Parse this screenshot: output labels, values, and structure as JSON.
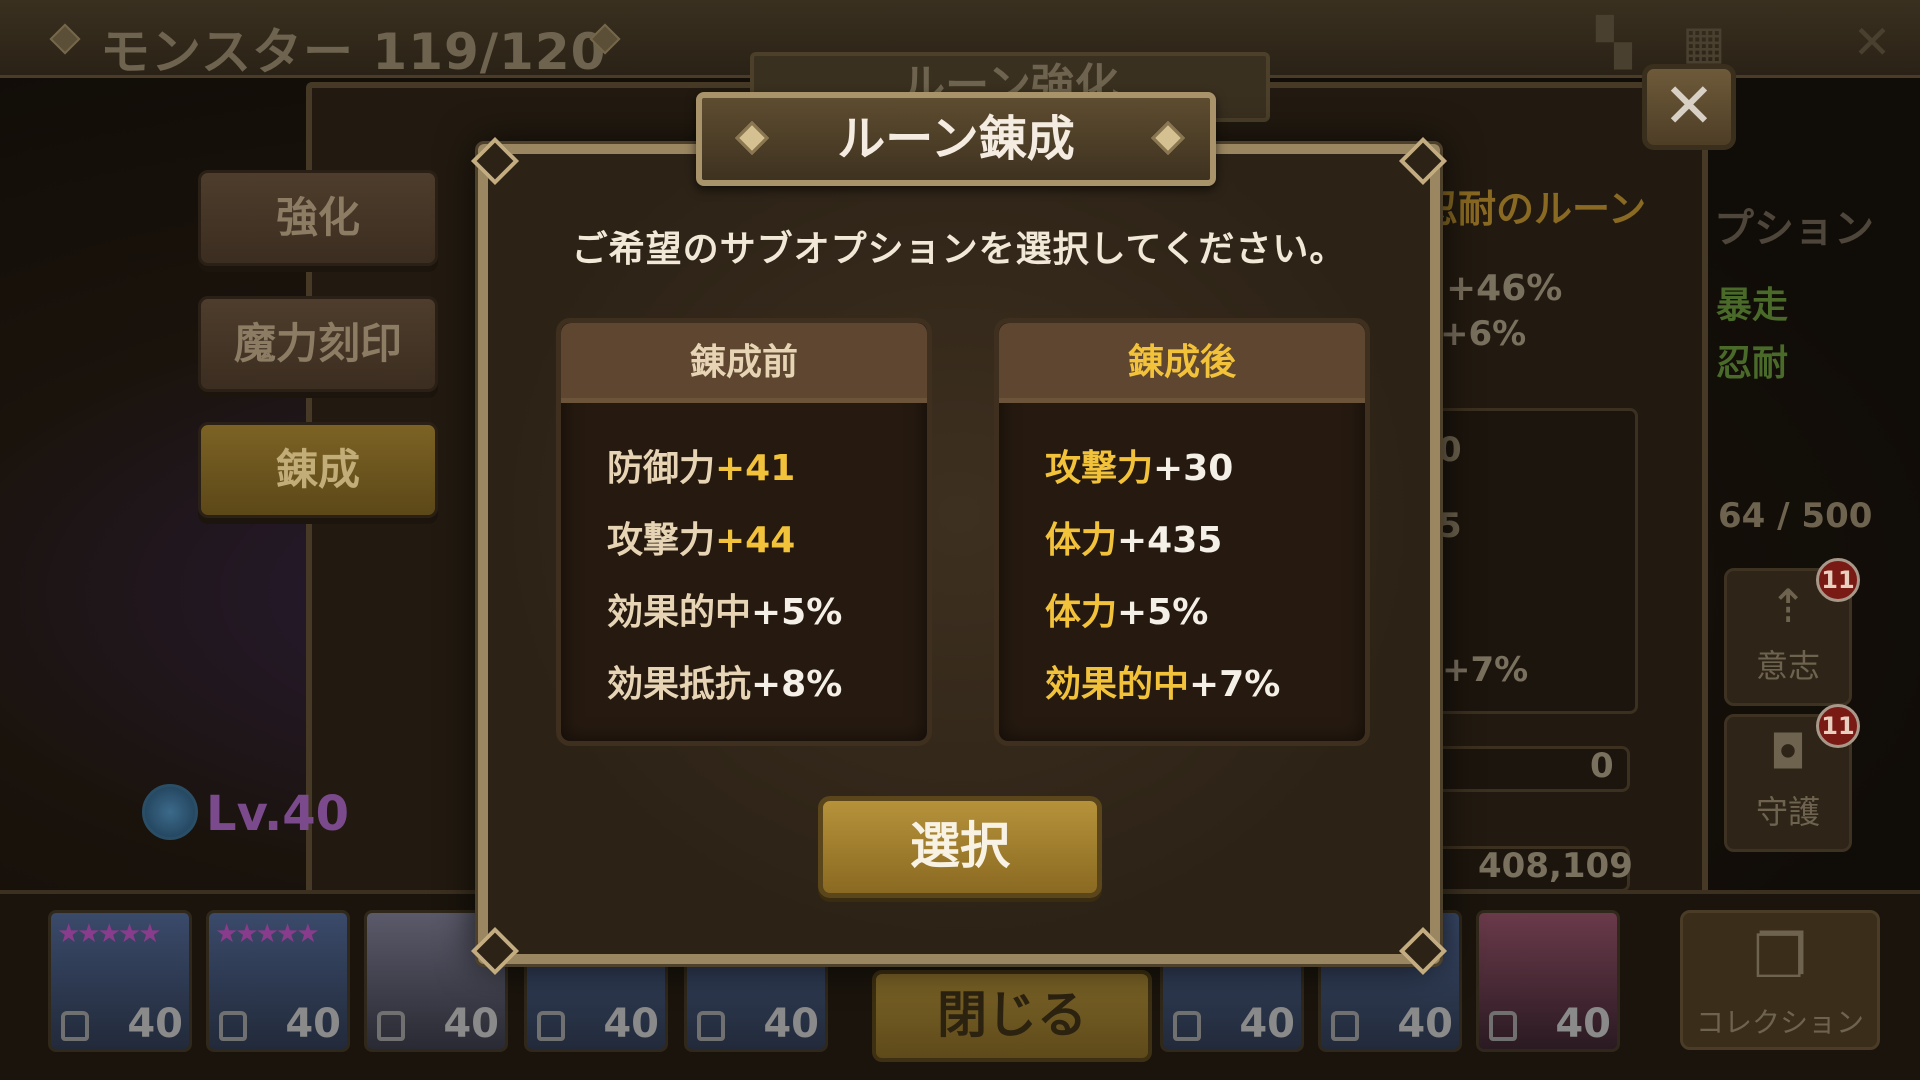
{
  "topbar": {
    "title": "モンスター 119/120"
  },
  "background": {
    "subtitle": "ルーン強化",
    "side_tabs": [
      {
        "label": "強化"
      },
      {
        "label": "魔力刻印"
      },
      {
        "label": "錬成"
      }
    ],
    "level_text": "Lv.40",
    "rune_name_fragment": "忍耐のルーン",
    "options_fragment": "プション",
    "stat_fragments": [
      "+46%",
      "+6%",
      "0",
      "5",
      "+7%"
    ],
    "set_fragments": [
      "暴走",
      "忍耐"
    ],
    "capacity": "64 / 500",
    "buttons": [
      {
        "label": "意志",
        "badge": "11"
      },
      {
        "label": "守護",
        "badge": "11"
      }
    ],
    "currency_1": "0",
    "currency_2": "408,109",
    "close_label": "閉じる",
    "collection_label": "コレクション",
    "monster_levels": [
      "40",
      "40",
      "40",
      "40",
      "40",
      "40",
      "40",
      "40"
    ],
    "monster_stars": "★★★★★"
  },
  "modal": {
    "title": "ルーン錬成",
    "instruction": "ご希望のサブオプションを選択してください。",
    "before": {
      "header": "錬成前",
      "stats": [
        {
          "name": "防御力",
          "value": "+41"
        },
        {
          "name": "攻撃力",
          "value": "+44"
        },
        {
          "name": "効果的中",
          "value": "+5%"
        },
        {
          "name": "効果抵抗",
          "value": "+8%"
        }
      ]
    },
    "after": {
      "header": "錬成後",
      "stats": [
        {
          "name": "攻撃力",
          "value": "+30"
        },
        {
          "name": "体力",
          "value": "+435"
        },
        {
          "name": "体力",
          "value": "+5%"
        },
        {
          "name": "効果的中",
          "value": "+7%"
        }
      ]
    },
    "select_label": "選択",
    "close_symbol": "✕"
  },
  "colors": {
    "gold_value": "#f2c23a",
    "white_value": "#f4f0e8",
    "before_header": "#e6d4b4",
    "after_header": "#f2c23a",
    "modal_border": "#9a8660"
  }
}
